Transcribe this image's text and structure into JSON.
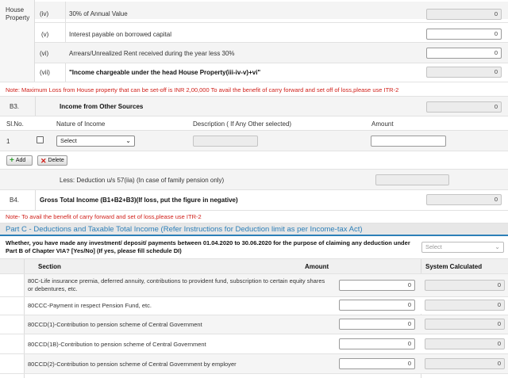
{
  "house_property": {
    "section_label": "House Property",
    "rows": [
      {
        "num": "(iv)",
        "label": "30% of Annual Value",
        "value": "0",
        "editable": false
      },
      {
        "num": "(v)",
        "label": "Interest payable on borrowed capital",
        "value": "0",
        "editable": true
      },
      {
        "num": "(vi)",
        "label": "Arrears/Unrealized Rent received during the year less 30%",
        "value": "0",
        "editable": true
      },
      {
        "num": "(vii)",
        "label": "\"Income chargeable under the head House Property(iii-iv-v)+vi\"",
        "value": "0",
        "editable": false
      }
    ],
    "note": "Note: Maximum Loss from House property that can be set-off is INR 2,00,000 To avail the benefit of carry forward and set off of loss,please use ITR-2"
  },
  "other_sources": {
    "code": "B3.",
    "title": "Income from Other Sources",
    "value": "0",
    "columns": [
      "Sl.No.",
      "Nature of Income",
      "Description ( If Any Other selected)",
      "Amount"
    ],
    "row": {
      "sl": "1",
      "select_value": "Select",
      "description": "",
      "amount": ""
    },
    "add_label": "Add",
    "delete_label": "Delete",
    "deduction_label": "Less: Deduction u/s 57(iia) (In case of family pension only)",
    "deduction_value": ""
  },
  "gross_total": {
    "code": "B4.",
    "title": "Gross Total Income (B1+B2+B3)(If loss, put the figure in negative)",
    "value": "0",
    "note": "Note- To avail the benefit of carry forward and set of loss,please use ITR-2"
  },
  "part_c": {
    "title": "Part C - Deductions and Taxable Total Income (Refer Instructions for Deduction limit as per Income-tax Act)",
    "question": "Whether, you have made any investment/ deposit/ payments between 01.04.2020 to 30.06.2020 for the purpose of claiming any deduction under Part B of Chapter VIA? [Yes/No] (If yes, please fill schedule DI)",
    "question_select": "Select",
    "columns": [
      "Section",
      "Amount",
      "System Calculated"
    ],
    "rows": [
      {
        "label": "80C-Life insurance premia, deferred annuity, contributions to provident fund, subscription to certain equity shares or debentures, etc.",
        "amount": "0",
        "system": "0"
      },
      {
        "label": "80CCC-Payment in respect Pension Fund, etc.",
        "amount": "0",
        "system": "0"
      },
      {
        "label": "80CCD(1)-Contribution to pension scheme of Central Government",
        "amount": "0",
        "system": "0"
      },
      {
        "label": "80CCD(1B)-Contribution to pension scheme of Central Government",
        "amount": "0",
        "system": "0"
      },
      {
        "label": "80CCD(2)-Contribution to pension scheme of Central Government by employer",
        "amount": "0",
        "system": "0"
      }
    ]
  },
  "colors": {
    "accent_blue": "#2c7fb8",
    "note_red": "#d0201a",
    "header_bg": "#e8e8e8",
    "row_alt": "#f4f4f4"
  }
}
